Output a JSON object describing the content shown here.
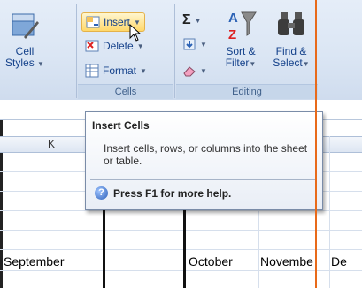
{
  "ribbon": {
    "cell_styles": {
      "label_line1": "Cell",
      "label_line2": "Styles"
    },
    "insert": {
      "label": "Insert"
    },
    "delete": {
      "label": "Delete"
    },
    "format": {
      "label": "Format"
    },
    "cells_group_label": "Cells",
    "sigma": "Σ",
    "sort": {
      "label_line1": "Sort &",
      "label_line2": "Filter"
    },
    "find": {
      "label_line1": "Find &",
      "label_line2": "Select"
    },
    "editing_group_label": "Editing"
  },
  "sheet": {
    "column_k": "K",
    "cells": [
      "September",
      "October",
      "Novembe",
      "De"
    ]
  },
  "tooltip": {
    "title": "Insert Cells",
    "description": "Insert cells, rows, or columns into the sheet or table.",
    "help": "Press F1 for more help.",
    "help_glyph": "?"
  },
  "colors": {
    "accent_line": "#e86a1a",
    "ribbon_text": "#15428b"
  }
}
